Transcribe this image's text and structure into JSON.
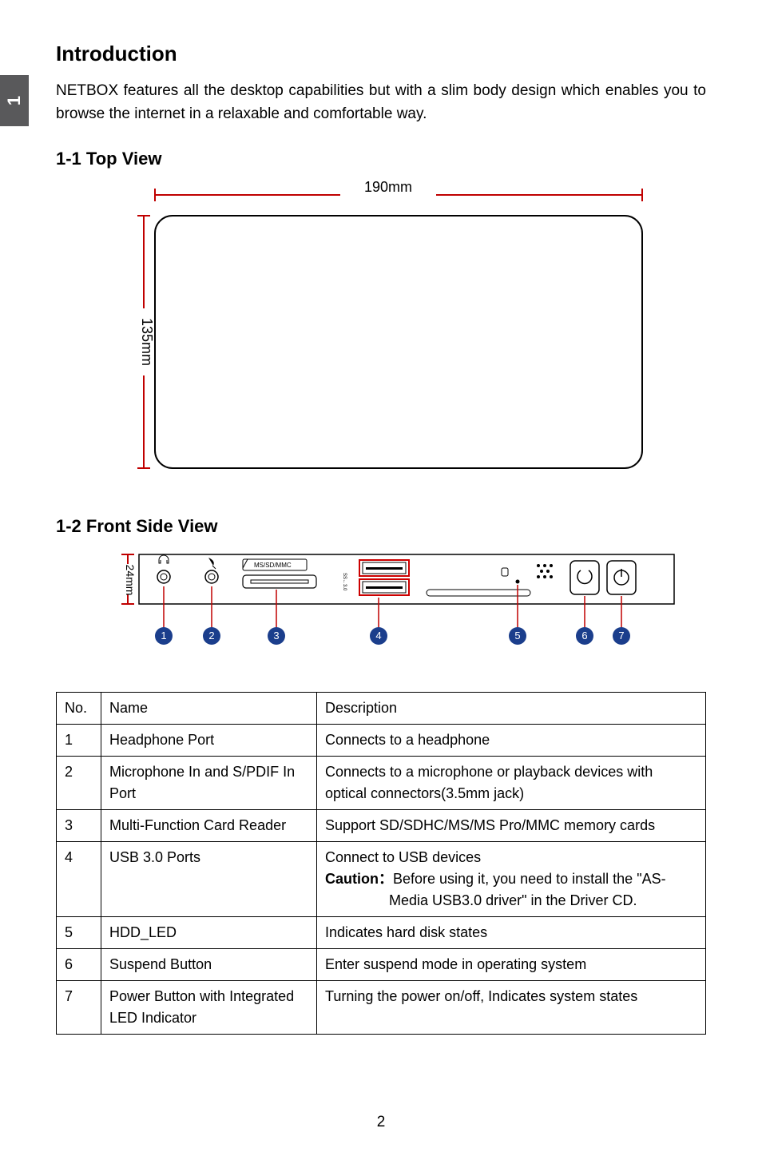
{
  "sideTab": "1",
  "headings": {
    "intro": "Introduction",
    "topView": "1-1 Top View",
    "frontView": "1-2 Front Side View"
  },
  "introText": "NETBOX features all the desktop capabilities but with a slim body design which enables you to browse the internet in a relaxable and comfortable way.",
  "topDiagram": {
    "widthLabel": "190mm",
    "heightLabel": "135mm"
  },
  "frontDiagram": {
    "heightLabel": "24mm",
    "cardSlotLabel": "MS/SD/MMC",
    "usbLabel": "SS←3.0",
    "callouts": [
      "1",
      "2",
      "3",
      "4",
      "5",
      "6",
      "7"
    ]
  },
  "table": {
    "headers": {
      "no": "No.",
      "name": "Name",
      "desc": "Description"
    },
    "rows": [
      {
        "no": "1",
        "name": "Headphone  Port",
        "descHtml": "Connects to a headphone"
      },
      {
        "no": "2",
        "name": "Microphone In and S/PDIF In Port",
        "descHtml": "Connects to a microphone or playback devices with optical connectors(3.5mm jack)"
      },
      {
        "no": "3",
        "name": "Multi-Function Card Reader",
        "descHtml": "Support SD/SDHC/MS/MS Pro/MMC memory cards"
      },
      {
        "no": "4",
        "name": "USB 3.0 Ports",
        "descHtml": "Connect to USB devices<br><span class=\"caution\">Caution：</span>Before using it, you need to install the \"AS-<br>&nbsp;&nbsp;&nbsp;&nbsp;&nbsp;&nbsp;&nbsp;&nbsp;&nbsp;&nbsp;&nbsp;&nbsp;&nbsp;&nbsp;&nbsp;&nbsp;Media USB3.0 driver\" in the Driver CD."
      },
      {
        "no": "5",
        "name": "HDD_LED",
        "descHtml": "Indicates hard disk states"
      },
      {
        "no": "6",
        "name": "Suspend Button",
        "descHtml": "Enter suspend mode in operating system"
      },
      {
        "no": "7",
        "name": "Power Button with Integrated LED Indicator",
        "descHtml": "Turning the power on/off, <b style=\"font-weight:normal\">Indicates system states</b>"
      }
    ]
  },
  "pageNumber": "2"
}
